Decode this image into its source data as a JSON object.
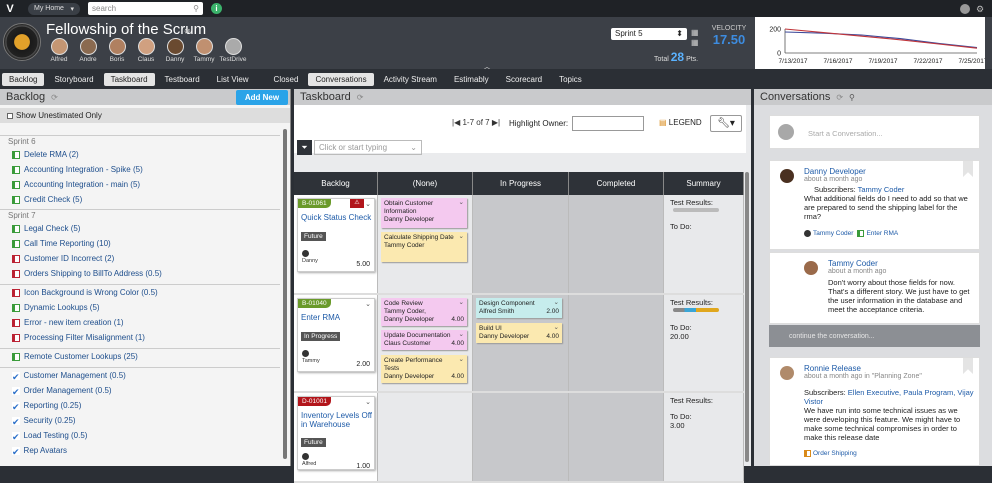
{
  "topbar": {
    "home_label": "My Home",
    "search_placeholder": "search"
  },
  "team": {
    "name": "Fellowship of the Scrum",
    "members": [
      "Alfred",
      "Andre",
      "Boris",
      "Claus",
      "Danny",
      "Tammy",
      "TestDrive"
    ]
  },
  "sprint": {
    "selected": "Sprint 5",
    "total_label": "Total",
    "total_value": "28",
    "total_unit": "Pts."
  },
  "velocity": {
    "label": "VELOCITY",
    "value": "17.50"
  },
  "chart_data": {
    "type": "line",
    "x": [
      "7/13/2017",
      "7/16/2017",
      "7/19/2017",
      "7/22/2017",
      "7/25/2017"
    ],
    "y_ticks": [
      "200",
      "0"
    ],
    "ylim": [
      0,
      200
    ],
    "series": [
      {
        "color": "#3d4a9a",
        "values": [
          175,
          165,
          150,
          120,
          80,
          45
        ]
      },
      {
        "color": "#c0353a",
        "values": [
          200,
          170,
          140,
          110,
          75,
          40
        ]
      }
    ]
  },
  "tabs": {
    "items": [
      "Backlog",
      "Storyboard",
      "Taskboard",
      "Testboard",
      "List View"
    ],
    "items2": [
      "Closed",
      "Conversations",
      "Activity Stream",
      "Estimably",
      "Scorecard",
      "Topics"
    ]
  },
  "backlog": {
    "title": "Backlog",
    "add_new": "Add New",
    "show_unestimated": "Show Unestimated Only",
    "sprint6_label": "Sprint 6",
    "sprint6": [
      "Delete RMA (2)",
      "Accounting Integration - Spike (5)",
      "Accounting Integration - main (5)",
      "Credit Check (5)"
    ],
    "sprint7_label": "Sprint 7",
    "sprint7": [
      "Legal Check (5)",
      "Call Time Reporting (10)",
      "Customer ID Incorrect (2)",
      "Orders Shipping to BillTo Address (0.5)"
    ],
    "group3": [
      "Icon Background is Wrong Color (0.5)",
      "Dynamic Lookups (5)",
      "Error - new item creation (1)",
      "Processing Filter Misalignment (1)"
    ],
    "group4": [
      "Remote Customer Lookups (25)"
    ],
    "group5": [
      "Customer Management (0.5)",
      "Order Management (0.5)",
      "Reporting (0.25)",
      "Security (0.25)",
      "Load Testing (0.5)",
      "Rep Avatars"
    ]
  },
  "taskboard": {
    "title": "Taskboard",
    "pager": "1-7 of 7",
    "highlight_owner": "Highlight Owner:",
    "legend": "LEGEND",
    "filter_placeholder": "Click or start typing",
    "columns": [
      "Backlog",
      "(None)",
      "In Progress",
      "Completed",
      "Summary"
    ],
    "rows": [
      {
        "story": {
          "id": "B-01061",
          "title": "Quick Status Check",
          "status": "Future",
          "owner": "Danny",
          "points": "5.00"
        },
        "none": [
          {
            "text": "Obtain Customer Information",
            "owner": "Danny Developer",
            "value": ""
          },
          {
            "text": "Calculate Shipping Date",
            "owner": "Tammy Coder",
            "value": ""
          }
        ],
        "inprogress": [],
        "summary": {
          "test": "Test Results:",
          "todo": "To Do:",
          "todo_value": ""
        }
      },
      {
        "story": {
          "id": "B-01040",
          "title": "Enter RMA",
          "status": "In Progress",
          "owner": "Tammy",
          "points": "2.00"
        },
        "none": [
          {
            "text": "Code Review",
            "owner": "Tammy Coder, Danny Developer",
            "value": "4.00"
          },
          {
            "text": "Update Documentation",
            "owner": "Claus Customer",
            "value": "4.00"
          },
          {
            "text": "Create Performance Tests",
            "owner": "Danny Developer",
            "value": "4.00"
          }
        ],
        "inprogress": [
          {
            "text": "Design Component",
            "owner": "Alfred Smith",
            "value": "2.00"
          },
          {
            "text": "Build UI",
            "owner": "Danny Developer",
            "value": "4.00"
          }
        ],
        "summary": {
          "test": "Test Results:",
          "todo": "To Do:",
          "todo_value": "20.00"
        }
      },
      {
        "story": {
          "id": "D-01001",
          "title": "Inventory Levels Off in Warehouse",
          "status": "Future",
          "owner": "Alfred",
          "points": "1.00"
        },
        "none": [],
        "inprogress": [],
        "summary": {
          "test": "Test Results:",
          "todo": "To Do:",
          "todo_value": "3.00"
        }
      }
    ]
  },
  "conversations": {
    "title": "Conversations",
    "start_placeholder": "Start a Conversation...",
    "items": [
      {
        "name": "Danny Developer",
        "meta": "about a month ago",
        "subs_label": "Subscribers:",
        "subs": "Tammy Coder",
        "body": "What additional fields do I need to add so that we are prepared to send the shipping label for the rma?",
        "tags": [
          "Tammy Coder",
          "Enter RMA"
        ]
      },
      {
        "name": "Tammy Coder",
        "meta": "about a month ago",
        "body": "Don't worry about those fields for now. That's a different story. We just have to get the user information in the database and meet the acceptance criteria."
      },
      {
        "name": "Ronnie Release",
        "meta": "about a month ago in \"Planning Zone\"",
        "subs_label": "Subscribers:",
        "subs": "Ellen Executive, Paula Program, Vijay Vistor",
        "body": "We have run into some technical issues as we were developing this feature. We might have to make some technical compromises in order to make this release date",
        "tags": [
          "Order Shipping"
        ]
      }
    ],
    "continue": "continue the conversation..."
  }
}
